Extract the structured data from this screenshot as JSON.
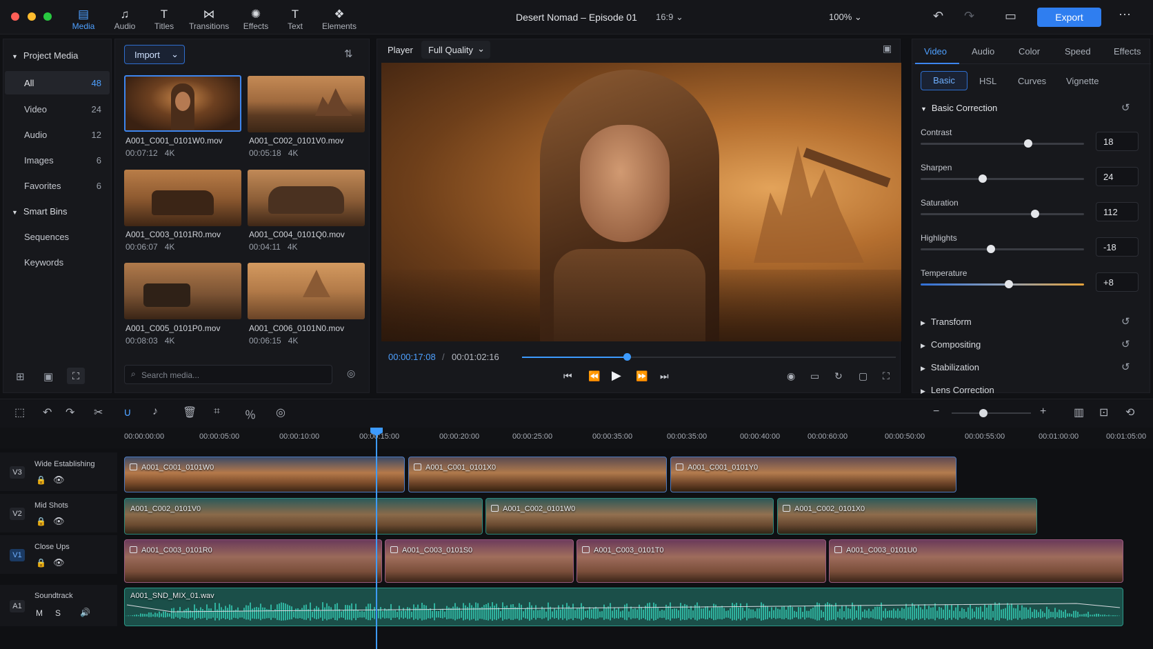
{
  "window": {
    "title": "Desert Nomad – Episode 01",
    "aspect": "16:9",
    "zoom": "100%",
    "export_label": "Export"
  },
  "toolbar": [
    {
      "label": "Media",
      "icon": "media-icon"
    },
    {
      "label": "Audio",
      "icon": "music-note-icon"
    },
    {
      "label": "Titles",
      "icon": "titles-icon"
    },
    {
      "label": "Transitions",
      "icon": "transitions-icon"
    },
    {
      "label": "Effects",
      "icon": "effects-icon"
    },
    {
      "label": "Text",
      "icon": "text-icon"
    },
    {
      "label": "Elements",
      "icon": "elements-icon"
    }
  ],
  "sidebar": {
    "project_media": "Project Media",
    "items": [
      {
        "label": "All",
        "count": "48"
      },
      {
        "label": "Video",
        "count": "24"
      },
      {
        "label": "Audio",
        "count": "12"
      },
      {
        "label": "Images",
        "count": "6"
      },
      {
        "label": "Favorites",
        "count": "6"
      }
    ],
    "smart_bins": "Smart Bins",
    "bins": [
      "Sequences",
      "Keywords"
    ]
  },
  "media": {
    "import_label": "Import",
    "search_placeholder": "Search media...",
    "clips": [
      {
        "name": "A001_C001_0101W0.mov",
        "duration": "00:07:12",
        "res": "4K"
      },
      {
        "name": "A001_C002_0101V0.mov",
        "duration": "00:05:18",
        "res": "4K"
      },
      {
        "name": "A001_C003_0101R0.mov",
        "duration": "00:06:07",
        "res": "4K"
      },
      {
        "name": "A001_C004_0101Q0.mov",
        "duration": "00:04:11",
        "res": "4K"
      },
      {
        "name": "A001_C005_0101P0.mov",
        "duration": "00:08:03",
        "res": "4K"
      },
      {
        "name": "A001_C006_0101N0.mov",
        "duration": "00:06:15",
        "res": "4K"
      }
    ]
  },
  "player": {
    "label": "Player",
    "quality": "Full Quality",
    "current_time": "00:00:17:08",
    "separator": "/",
    "total_time": "00:01:02:16",
    "progress": 0.28
  },
  "inspector": {
    "tabs": [
      "Video",
      "Audio",
      "Color",
      "Speed",
      "Effects"
    ],
    "subtabs": [
      "Basic",
      "HSL",
      "Curves",
      "Vignette"
    ],
    "section": "Basic Correction",
    "sliders": [
      {
        "label": "Contrast",
        "value": "18",
        "level": 0.66
      },
      {
        "label": "Sharpen",
        "value": "24",
        "level": 0.38
      },
      {
        "label": "Saturation",
        "value": "112",
        "level": 0.7
      },
      {
        "label": "Highlights",
        "value": "-18",
        "level": 0.43
      },
      {
        "label": "Temperature",
        "value": "+8",
        "level": 0.54
      }
    ],
    "collapsed": [
      "Transform",
      "Compositing",
      "Stabilization",
      "Lens Correction"
    ]
  },
  "timeline": {
    "ruler": [
      "00:00:00:00",
      "00:00:05:00",
      "00:00:10:00",
      "00:00:15:00",
      "00:00:20:00",
      "00:00:25:00",
      "00:00:35:00",
      "00:00:35:00",
      "00:00:40:00",
      "00:00:60:00",
      "00:00:50:00",
      "00:00:55:00",
      "00:01:00:00",
      "00:01:05:00"
    ],
    "tracks": [
      {
        "id": "V3",
        "name": "Wide Establishing",
        "clips": [
          "A001_C001_0101W0",
          "A001_C001_0101X0",
          "A001_C001_0101Y0"
        ]
      },
      {
        "id": "V2",
        "name": "Mid Shots",
        "clips": [
          "A001_C002_0101V0",
          "A001_C002_0101W0",
          "A001_C002_0101X0"
        ]
      },
      {
        "id": "V1",
        "name": "Close Ups",
        "clips": [
          "A001_C003_0101R0",
          "A001_C003_0101S0",
          "A001_C003_0101T0",
          "A001_C003_0101U0"
        ]
      },
      {
        "id": "A1",
        "name": "Soundtrack",
        "clips": [
          "A001_SND_MIX_01.wav"
        ],
        "mute": "M",
        "solo": "S"
      }
    ]
  },
  "colors": {
    "accent": "#2f7ef0",
    "playhead": "#3d9bff",
    "audio": "#1f8a7e",
    "v1_clip": "#8a4a6a"
  }
}
